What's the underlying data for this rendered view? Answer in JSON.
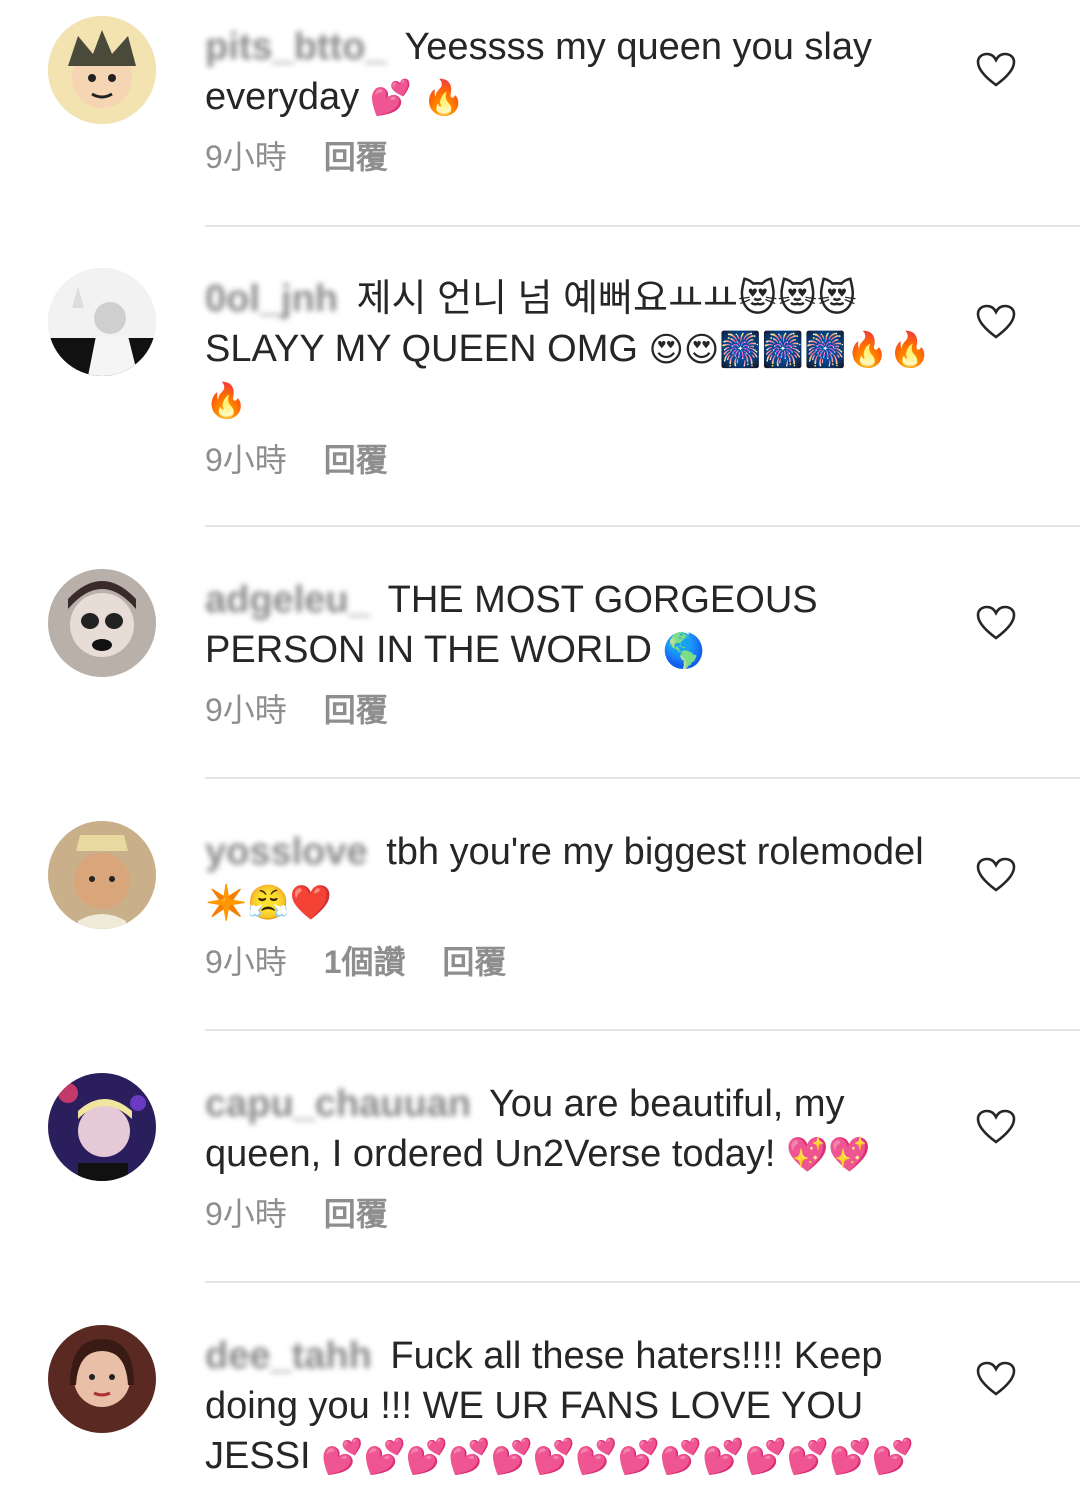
{
  "comments": [
    {
      "username": "pits_btto_",
      "text": "Yeessss my queen you slay everyday",
      "emoji": "💕 🔥",
      "time": "9小時",
      "likes": "",
      "reply": "回覆",
      "avatar_color": "#e8c36a"
    },
    {
      "username": "0ol_jnh",
      "text": "제시 언니 넘 예뻐요ㅛㅛ😻😻😻 SLAYY MY QUEEN OMG",
      "emoji": "😍😍🎆🎆🎆🔥🔥🔥",
      "time": "9小時",
      "likes": "",
      "reply": "回覆",
      "avatar_color": "#555555"
    },
    {
      "username": "adgeleu_",
      "text": "THE MOST GORGEOUS PERSON IN THE WORLD",
      "emoji": "🌎",
      "time": "9小時",
      "likes": "",
      "reply": "回覆",
      "avatar_color": "#6b5a55"
    },
    {
      "username": "yosslove",
      "text": "tbh you're my biggest rolemodel",
      "emoji": "✴️😤❤️",
      "time": "9小時",
      "likes": "1個讚",
      "reply": "回覆",
      "avatar_color": "#8c6a4a"
    },
    {
      "username": "capu_chauuan",
      "text": "You are beautiful, my queen, I ordered Un2Verse today!",
      "emoji": "💖💖",
      "time": "9小時",
      "likes": "",
      "reply": "回覆",
      "avatar_color": "#3b2f7a"
    },
    {
      "username": "dee_tahh",
      "text": "Fuck all these haters!!!! Keep doing you !!! WE UR FANS LOVE YOU JESSI",
      "emoji": "💕💕💕💕💕💕💕💕💕💕💕💕💕💕",
      "time": "",
      "likes": "",
      "reply": "",
      "avatar_color": "#7a4a3a"
    }
  ],
  "icons": {
    "like": "heart-outline-icon"
  }
}
